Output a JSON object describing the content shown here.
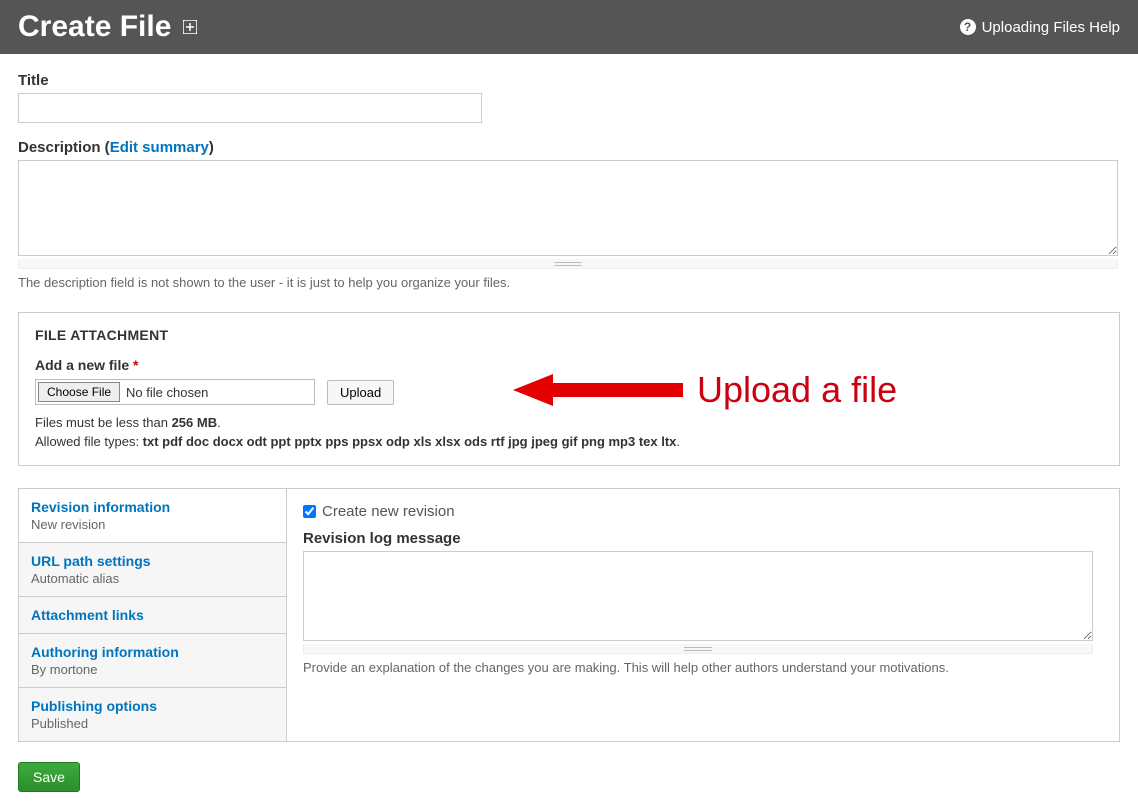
{
  "header": {
    "title": "Create File",
    "help_link": "Uploading Files Help"
  },
  "form": {
    "title_label": "Title",
    "title_value": "",
    "description_label_prefix": "Description (",
    "description_edit_summary": "Edit summary",
    "description_label_suffix": ")",
    "description_value": "",
    "description_help": "The description field is not shown to the user - it is just to help you organize your files."
  },
  "attachment": {
    "legend": "FILE ATTACHMENT",
    "add_file_label": "Add a new file",
    "required_mark": "*",
    "choose_file_btn": "Choose File",
    "no_file_text": "No file chosen",
    "upload_btn": "Upload",
    "size_limit_prefix": "Files must be less than ",
    "size_limit_value": "256 MB",
    "size_limit_suffix": ".",
    "types_prefix": "Allowed file types: ",
    "types_value": "txt pdf doc docx odt ppt pptx pps ppsx odp xls xlsx ods rtf jpg jpeg gif png mp3 tex ltx",
    "types_suffix": "."
  },
  "annotation": {
    "text": "Upload a file"
  },
  "vtabs": {
    "tabs": [
      {
        "title": "Revision information",
        "sub": "New revision"
      },
      {
        "title": "URL path settings",
        "sub": "Automatic alias"
      },
      {
        "title": "Attachment links",
        "sub": ""
      },
      {
        "title": "Authoring information",
        "sub": "By mortone"
      },
      {
        "title": "Publishing options",
        "sub": "Published"
      }
    ],
    "pane": {
      "create_revision_label": "Create new revision",
      "create_revision_checked": true,
      "log_label": "Revision log message",
      "log_value": "",
      "log_help": "Provide an explanation of the changes you are making. This will help other authors understand your motivations."
    }
  },
  "actions": {
    "save": "Save"
  }
}
